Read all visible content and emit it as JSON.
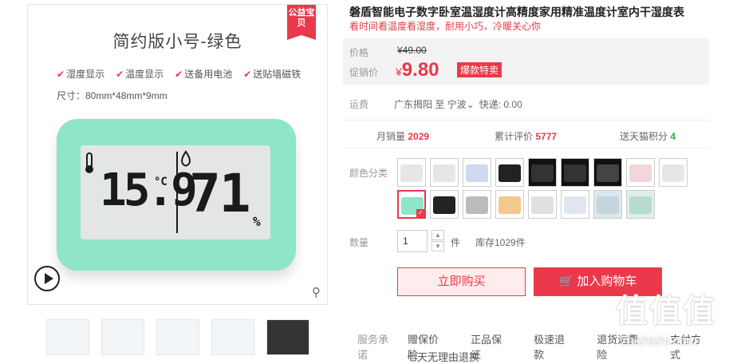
{
  "gallery": {
    "badge": "公益宝贝",
    "product_title": "简约版小号-绿色",
    "features": [
      "湿度显示",
      "温度显示",
      "送备用电池",
      "送贴墙磁铁"
    ],
    "size": "尺寸：80mm*48mm*9mm",
    "lcd_temp": "15.9",
    "lcd_unit": "°C",
    "lcd_humidity": "71",
    "lcd_percent": "%"
  },
  "product": {
    "title": "磐盾智能电子数字卧室温湿度计高精度家用精准温度计室内干湿度表",
    "subtitle": "看时间看温度看湿度，耐用小巧，冷暖关心你"
  },
  "price": {
    "label": "价格",
    "original": "¥49.00",
    "promo_label": "促销价",
    "currency": "¥",
    "current": "9.80",
    "promo_tag": "爆款特卖"
  },
  "shipping": {
    "label": "运费",
    "route": "广东揭阳 至 宁波",
    "express": "快递: 0.00"
  },
  "stats": {
    "monthly_sales_label": "月销量",
    "monthly_sales": "2029",
    "reviews_label": "累计评价",
    "reviews": "5777",
    "points_label": "送天猫积分",
    "points": "4"
  },
  "options": {
    "color_label": "颜色分类",
    "swatches": [
      {
        "bg": "#ffffff",
        "screen": "#e6e6e6"
      },
      {
        "bg": "#ffffff",
        "screen": "#e6e6e6"
      },
      {
        "bg": "#ffffff",
        "screen": "#cfd9f0"
      },
      {
        "bg": "#ffffff",
        "screen": "#222222"
      },
      {
        "bg": "#111111",
        "screen": "#333333"
      },
      {
        "bg": "#111111",
        "screen": "#333333"
      },
      {
        "bg": "#111111",
        "screen": "#444444"
      },
      {
        "bg": "#ffffff",
        "screen": "#f2d6da"
      },
      {
        "bg": "#ffffff",
        "screen": "#e6e6e6"
      },
      {
        "bg": "#ffffff",
        "screen": "#8ee5c7"
      },
      {
        "bg": "#ffffff",
        "screen": "#222222"
      },
      {
        "bg": "#ffffff",
        "screen": "#bbbbbb"
      },
      {
        "bg": "#ffffff",
        "screen": "#f2c98a"
      },
      {
        "bg": "#ffffff",
        "screen": "#e0e0e0"
      },
      {
        "bg": "#ffffff",
        "screen": "#dfe6f0"
      },
      {
        "bg": "#dde8ee",
        "screen": "#c6d4de"
      },
      {
        "bg": "#e0efe8",
        "screen": "#b6dccd"
      }
    ],
    "quantity_label": "数量",
    "quantity": "1",
    "unit": "件",
    "stock": "库存1029件"
  },
  "actions": {
    "buy_now": "立即购买",
    "add_to_cart": "加入购物车"
  },
  "service": {
    "label": "服务承诺",
    "items": [
      "赠保价险",
      "正品保证",
      "极速退款",
      "退货运费险",
      "支付方式"
    ],
    "more": "七天无理由退换"
  },
  "watermark": {
    "logo": "值值值",
    "site": "zhizhizhi.com"
  },
  "colors": {
    "accent": "#e9394a",
    "device": "#8ee5c7",
    "points": "#2fa84b"
  }
}
